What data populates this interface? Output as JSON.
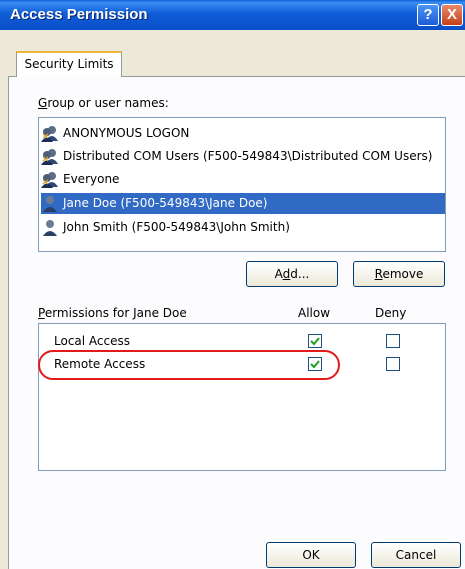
{
  "window": {
    "title": "Access Permission",
    "help_glyph": "?",
    "close_glyph": "X"
  },
  "tabs": [
    {
      "label": "Security Limits"
    }
  ],
  "groups": {
    "label_accel": "G",
    "label_rest": "roup or user names:",
    "items": [
      {
        "label": "ANONYMOUS LOGON",
        "icon": "group-icon",
        "selected": false
      },
      {
        "label": "Distributed COM Users (F500-549843\\Distributed COM Users)",
        "icon": "group-icon",
        "selected": false
      },
      {
        "label": "Everyone",
        "icon": "group-icon",
        "selected": false
      },
      {
        "label": "Jane Doe (F500-549843\\Jane Doe)",
        "icon": "user-icon",
        "selected": true
      },
      {
        "label": "John Smith (F500-549843\\John Smith)",
        "icon": "user-icon",
        "selected": false
      }
    ]
  },
  "buttons": {
    "add_pre": "A",
    "add_accel": "d",
    "add_post": "d...",
    "remove_accel": "R",
    "remove_post": "emove",
    "ok": "OK",
    "cancel": "Cancel"
  },
  "permissions": {
    "label_accel": "P",
    "label_rest": "ermissions for Jane Doe",
    "allow_header": "Allow",
    "deny_header": "Deny",
    "items": [
      {
        "label": "Local Access",
        "allow": true,
        "deny": false
      },
      {
        "label": "Remote Access",
        "allow": true,
        "deny": false,
        "highlighted": true
      }
    ]
  },
  "colors": {
    "highlight_oval": "#e31a1a",
    "selection": "#316ac5",
    "titlebar": "#0a5fd6"
  }
}
